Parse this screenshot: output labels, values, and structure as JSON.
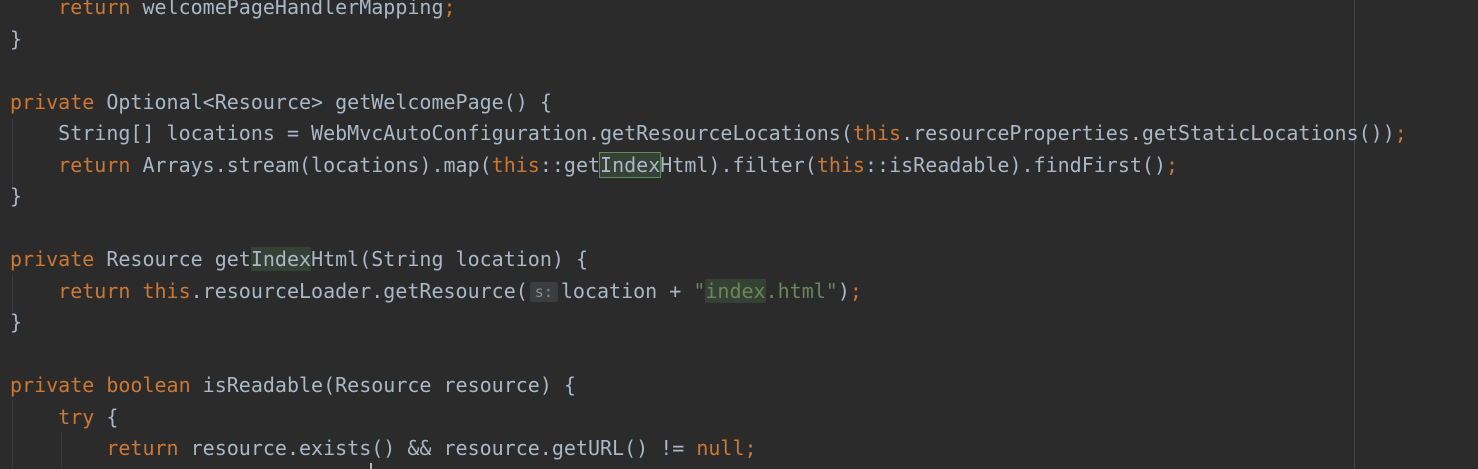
{
  "editor": {
    "lines": [
      {
        "indent": "    ",
        "tokens": [
          {
            "t": "return",
            "c": "kw"
          },
          {
            "t": " welcomePageHandlerMapping",
            "c": "id"
          },
          {
            "t": ";",
            "c": "kw"
          }
        ]
      },
      {
        "indent": "",
        "tokens": [
          {
            "t": "}",
            "c": "id"
          }
        ]
      },
      {
        "indent": "",
        "tokens": []
      },
      {
        "indent": "",
        "tokens": [
          {
            "t": "private",
            "c": "kw"
          },
          {
            "t": " Optional<Resource> getWelcomePage() {",
            "c": "id"
          }
        ]
      },
      {
        "indent": "    ",
        "tokens": [
          {
            "t": "String[] locations = WebMvcAutoConfiguration.getResourceLocations(",
            "c": "id"
          },
          {
            "t": "this",
            "c": "kw"
          },
          {
            "t": ".resourceProperties.getStaticLocations())",
            "c": "id"
          },
          {
            "t": ";",
            "c": "kw"
          }
        ]
      },
      {
        "indent": "    ",
        "tokens": [
          {
            "t": "return",
            "c": "kw"
          },
          {
            "t": " Arrays.stream(locations).map(",
            "c": "id"
          },
          {
            "t": "this",
            "c": "kw"
          },
          {
            "t": "::get",
            "c": "id"
          },
          {
            "t": "Index",
            "c": "id",
            "hl": "hl"
          },
          {
            "t": "Html).filter(",
            "c": "id"
          },
          {
            "t": "this",
            "c": "kw"
          },
          {
            "t": "::isReadable).findFirst()",
            "c": "id"
          },
          {
            "t": ";",
            "c": "kw"
          }
        ]
      },
      {
        "indent": "",
        "tokens": [
          {
            "t": "}",
            "c": "id"
          }
        ]
      },
      {
        "indent": "",
        "tokens": []
      },
      {
        "indent": "",
        "tokens": [
          {
            "t": "private",
            "c": "kw"
          },
          {
            "t": " Resource get",
            "c": "id"
          },
          {
            "t": "Index",
            "c": "id",
            "hl": "hl-soft"
          },
          {
            "t": "Html(String location) {",
            "c": "id"
          }
        ]
      },
      {
        "indent": "    ",
        "tokens": [
          {
            "t": "return",
            "c": "kw"
          },
          {
            "t": " ",
            "c": "id"
          },
          {
            "t": "this",
            "c": "kw"
          },
          {
            "t": ".resourceLoader.getResource(",
            "c": "id"
          },
          {
            "t": "s:",
            "c": "hint"
          },
          {
            "t": "location + ",
            "c": "id"
          },
          {
            "t": "\"",
            "c": "str"
          },
          {
            "t": "index",
            "c": "str",
            "hl": "hl-soft"
          },
          {
            "t": ".html\"",
            "c": "str"
          },
          {
            "t": ")",
            "c": "id"
          },
          {
            "t": ";",
            "c": "kw"
          }
        ]
      },
      {
        "indent": "",
        "tokens": [
          {
            "t": "}",
            "c": "id"
          }
        ]
      },
      {
        "indent": "",
        "tokens": []
      },
      {
        "indent": "",
        "tokens": [
          {
            "t": "private",
            "c": "kw"
          },
          {
            "t": " ",
            "c": "id"
          },
          {
            "t": "boolean",
            "c": "kw"
          },
          {
            "t": " isReadable(Resource resource) {",
            "c": "id"
          }
        ]
      },
      {
        "indent": "    ",
        "tokens": [
          {
            "t": "try",
            "c": "kw"
          },
          {
            "t": " {",
            "c": "id"
          }
        ]
      },
      {
        "indent": "        ",
        "tokens": [
          {
            "t": "return",
            "c": "kw"
          },
          {
            "t": " resource.exists() && resource.getURL() != ",
            "c": "id"
          },
          {
            "t": "null",
            "c": "kw"
          },
          {
            "t": ";",
            "c": "kw"
          }
        ]
      }
    ]
  }
}
